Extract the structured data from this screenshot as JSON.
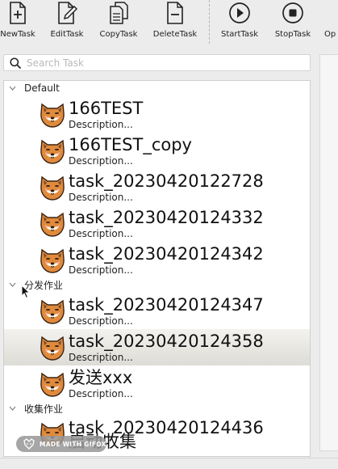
{
  "toolbar": {
    "buttons": [
      {
        "label": "NewTask",
        "icon": "new-file-icon"
      },
      {
        "label": "EditTask",
        "icon": "edit-file-icon"
      },
      {
        "label": "CopyTask",
        "icon": "copy-file-icon"
      },
      {
        "label": "DeleteTask",
        "icon": "delete-file-icon"
      },
      {
        "label": "StartTask",
        "icon": "play-icon"
      },
      {
        "label": "StopTask",
        "icon": "stop-icon"
      },
      {
        "label": "Op",
        "icon": "more-icon"
      }
    ]
  },
  "search": {
    "placeholder": "Search Task",
    "value": ""
  },
  "tree": {
    "groups": [
      {
        "label": "Default",
        "expanded": true
      },
      {
        "label": "分发作业",
        "expanded": true
      },
      {
        "label": "收集作业",
        "expanded": true
      }
    ],
    "tasks": [
      {
        "name": "166TEST",
        "description": "Description..."
      },
      {
        "name": "166TEST_copy",
        "description": "Description..."
      },
      {
        "name": "task_20230420122728",
        "description": "Description..."
      },
      {
        "name": "task_20230420124332",
        "description": "Description..."
      },
      {
        "name": "task_20230420124342",
        "description": "Description..."
      },
      {
        "name": "task_20230420124347",
        "description": "Description..."
      },
      {
        "name": "task_20230420124358",
        "description": "Description..."
      },
      {
        "name": "发送xxx",
        "description": "Description..."
      },
      {
        "name": "task_20230420124436",
        "description": ""
      },
      {
        "name": "启动收集",
        "description": ""
      }
    ],
    "selected_task": "task_20230420124358"
  },
  "watermark": {
    "text": "MADE WITH GIFOX"
  },
  "colors": {
    "selected_row": "#e4e3de",
    "toolbar_bg": "#ececec",
    "tree_bg": "#ffffff"
  }
}
